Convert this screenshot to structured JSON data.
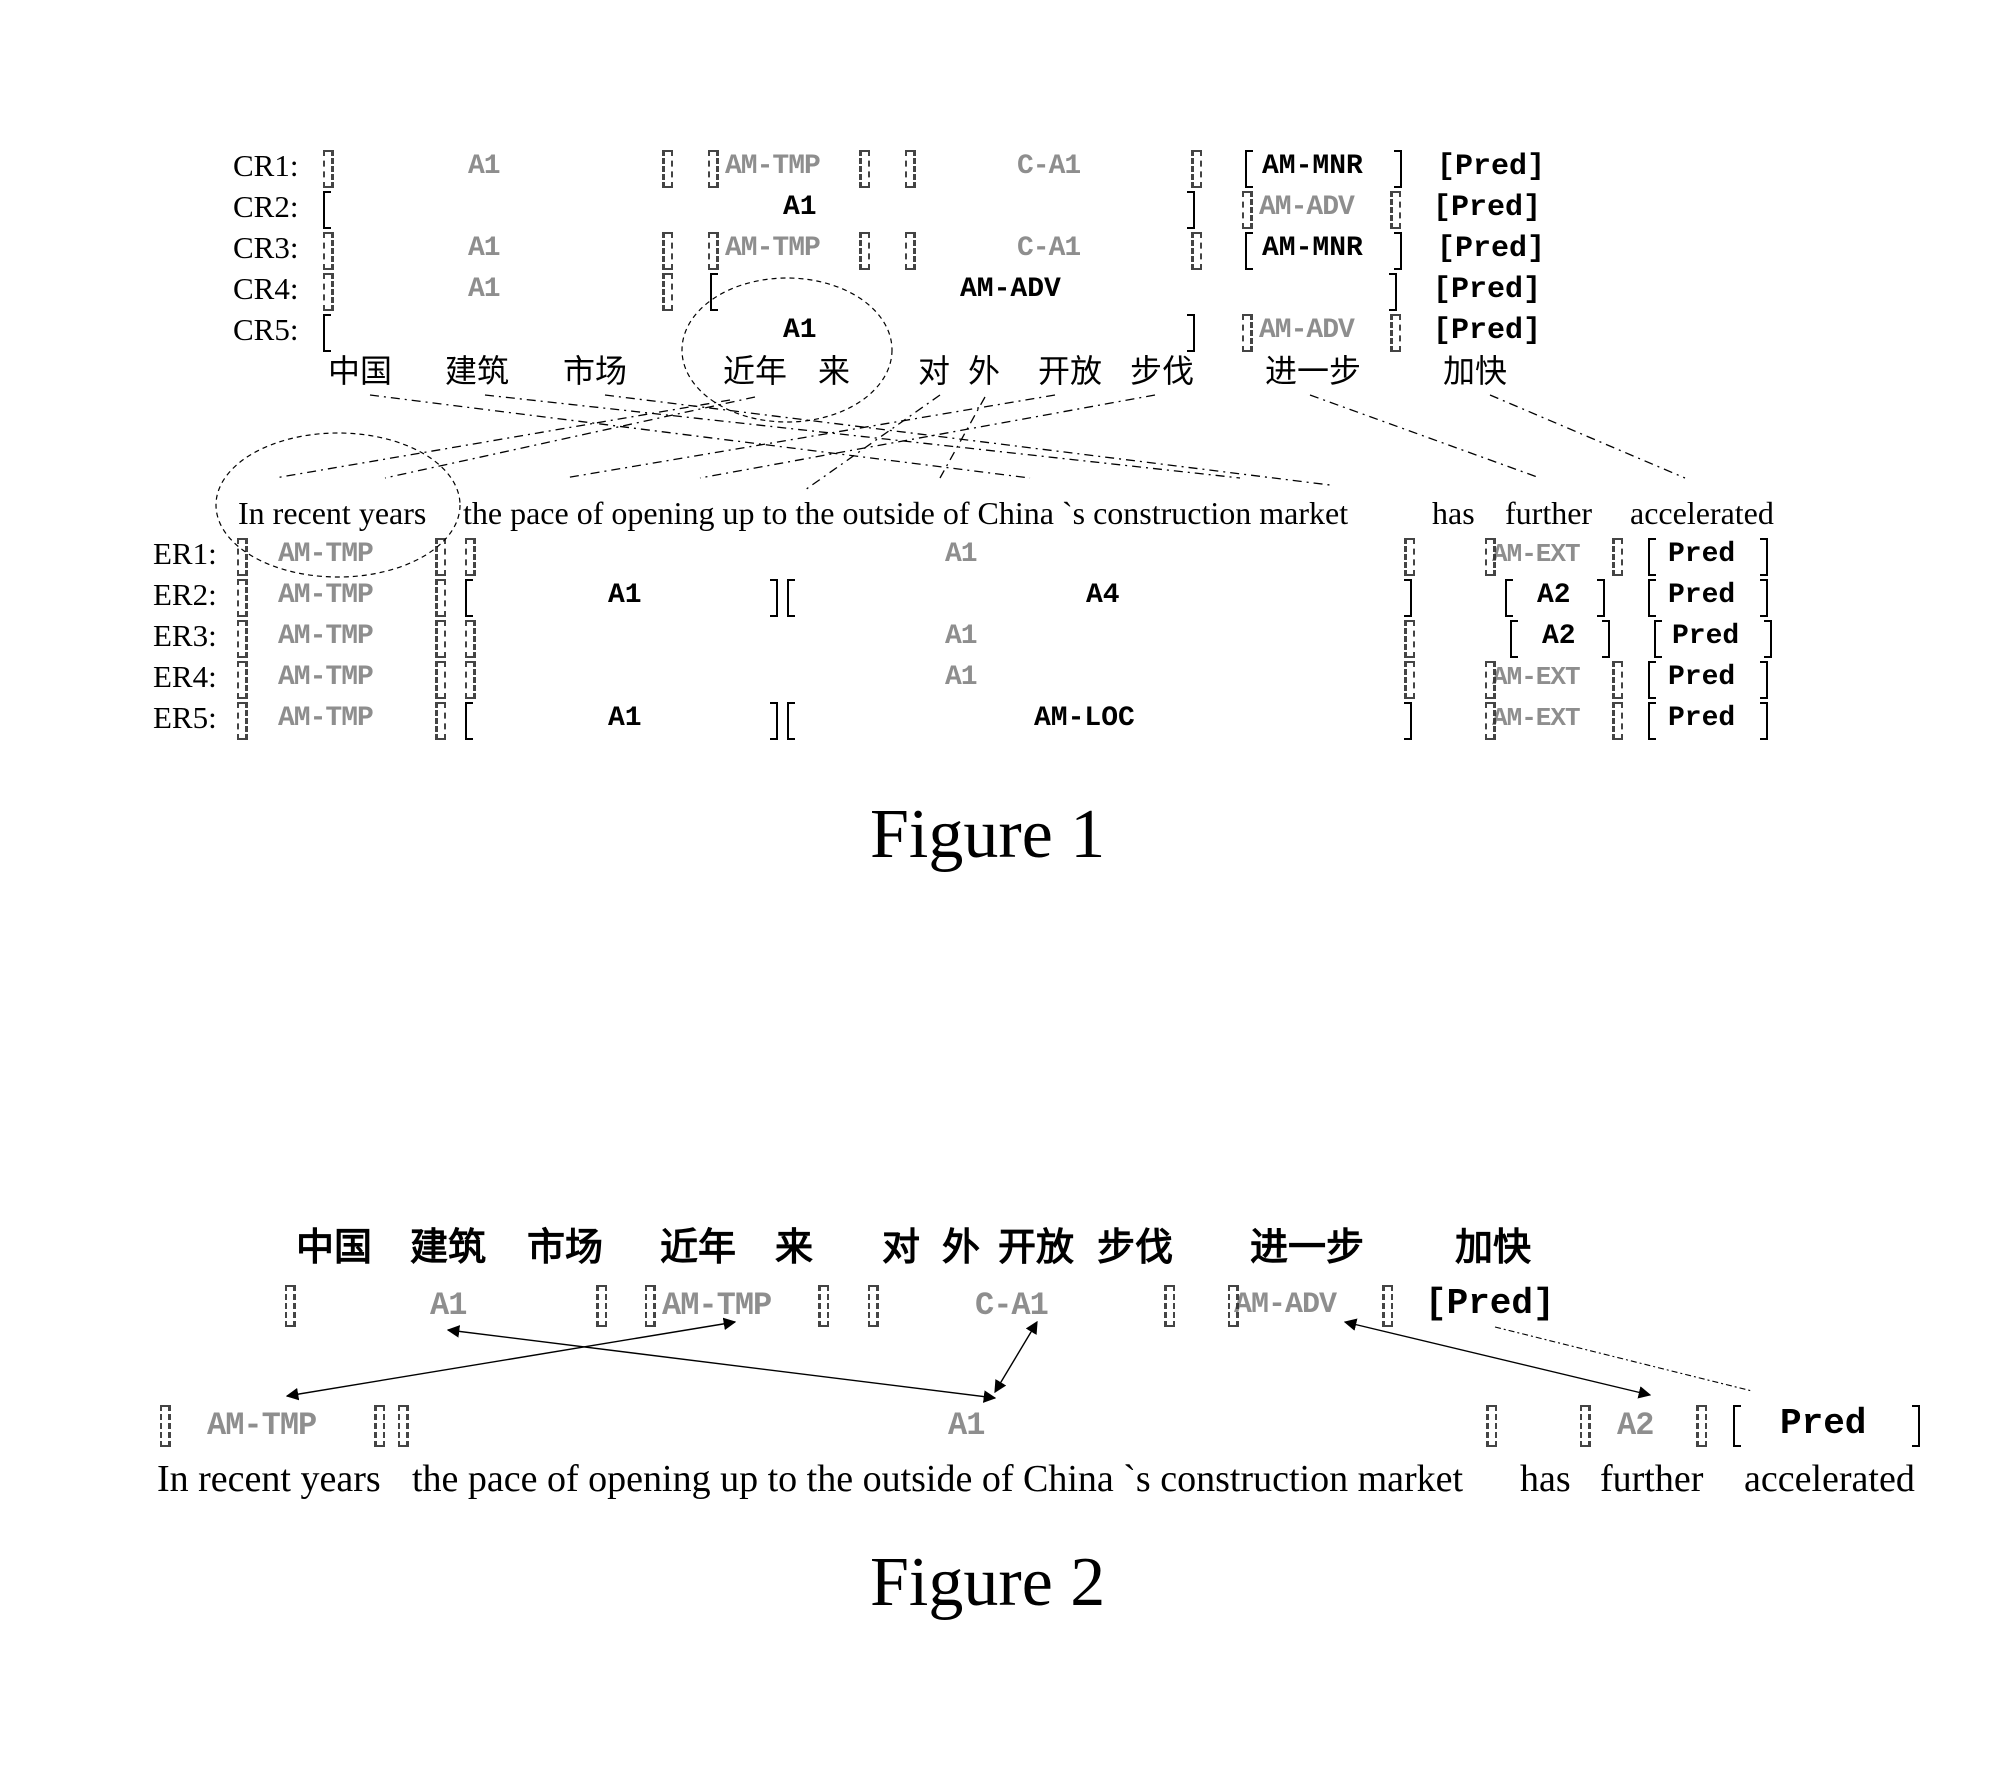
{
  "figure1": {
    "caption": "Figure 1",
    "chinese_words": [
      "中国",
      "建筑",
      "市场",
      "近年",
      "来",
      "对",
      "外",
      "开放",
      "步伐",
      "进一步",
      "加快"
    ],
    "english_words": [
      "In recent years",
      "the pace of opening up to the outside of China `s construction market",
      "has",
      "further",
      "accelerated"
    ],
    "cr_rows": [
      {
        "label": "CR1:",
        "args": [
          {
            "text": "A1",
            "style": "faint"
          },
          {
            "text": "AM-TMP",
            "style": "faint"
          },
          {
            "text": "C-A1",
            "style": "faint"
          },
          {
            "text": "AM-MNR",
            "style": "bold"
          },
          {
            "text": "[Pred]",
            "style": "bold"
          }
        ]
      },
      {
        "label": "CR2:",
        "args": [
          {
            "text": "A1",
            "style": "bold"
          },
          {
            "text": "AM-ADV",
            "style": "faint"
          },
          {
            "text": "[Pred]",
            "style": "bold"
          }
        ]
      },
      {
        "label": "CR3:",
        "args": [
          {
            "text": "A1",
            "style": "faint"
          },
          {
            "text": "AM-TMP",
            "style": "faint"
          },
          {
            "text": "C-A1",
            "style": "faint"
          },
          {
            "text": "AM-MNR",
            "style": "bold"
          },
          {
            "text": "[Pred]",
            "style": "bold"
          }
        ]
      },
      {
        "label": "CR4:",
        "args": [
          {
            "text": "A1",
            "style": "faint"
          },
          {
            "text": "AM-ADV",
            "style": "bold"
          },
          {
            "text": "[Pred]",
            "style": "bold"
          }
        ]
      },
      {
        "label": "CR5:",
        "args": [
          {
            "text": "A1",
            "style": "bold"
          },
          {
            "text": "AM-ADV",
            "style": "faint"
          },
          {
            "text": "[Pred]",
            "style": "bold"
          }
        ]
      }
    ],
    "er_rows": [
      {
        "label": "ER1:",
        "args": [
          {
            "text": "AM-TMP",
            "style": "faint"
          },
          {
            "text": "A1",
            "style": "faint"
          },
          {
            "text": "AM-EXT",
            "style": "faint"
          },
          {
            "text": "Pred",
            "style": "bold"
          }
        ]
      },
      {
        "label": "ER2:",
        "args": [
          {
            "text": "AM-TMP",
            "style": "faint"
          },
          {
            "text": "A1",
            "style": "bold"
          },
          {
            "text": "A4",
            "style": "bold"
          },
          {
            "text": "A2",
            "style": "bold"
          },
          {
            "text": "Pred",
            "style": "bold"
          }
        ]
      },
      {
        "label": "ER3:",
        "args": [
          {
            "text": "AM-TMP",
            "style": "faint"
          },
          {
            "text": "A1",
            "style": "faint"
          },
          {
            "text": "A2",
            "style": "bold"
          },
          {
            "text": "Pred",
            "style": "bold"
          }
        ]
      },
      {
        "label": "ER4:",
        "args": [
          {
            "text": "AM-TMP",
            "style": "faint"
          },
          {
            "text": "A1",
            "style": "faint"
          },
          {
            "text": "AM-EXT",
            "style": "faint"
          },
          {
            "text": "Pred",
            "style": "bold"
          }
        ]
      },
      {
        "label": "ER5:",
        "args": [
          {
            "text": "AM-TMP",
            "style": "faint"
          },
          {
            "text": "A1",
            "style": "bold"
          },
          {
            "text": "AM-LOC",
            "style": "bold"
          },
          {
            "text": "AM-EXT",
            "style": "faint"
          },
          {
            "text": "Pred",
            "style": "bold"
          }
        ]
      }
    ]
  },
  "figure2": {
    "caption": "Figure 2",
    "chinese_words": [
      "中国",
      "建筑",
      "市场",
      "近年",
      "来",
      "对",
      "外",
      "开放",
      "步伐",
      "进一步",
      "加快"
    ],
    "chinese_roles": [
      "A1",
      "AM-TMP",
      "C-A1",
      "AM-ADV",
      "[Pred]"
    ],
    "english_roles": [
      "AM-TMP",
      "A1",
      "A2",
      "Pred"
    ],
    "english_words": [
      "In recent years",
      "the pace of opening up to the outside of China `s construction market",
      "has",
      "further",
      "accelerated"
    ],
    "alignments": [
      {
        "from": "A1",
        "to": "A1"
      },
      {
        "from": "AM-TMP",
        "to": "AM-TMP"
      },
      {
        "from": "C-A1",
        "to": "A1"
      },
      {
        "from": "AM-ADV",
        "to": "A2"
      },
      {
        "from": "[Pred]",
        "to": "Pred",
        "style": "dotted"
      }
    ]
  }
}
